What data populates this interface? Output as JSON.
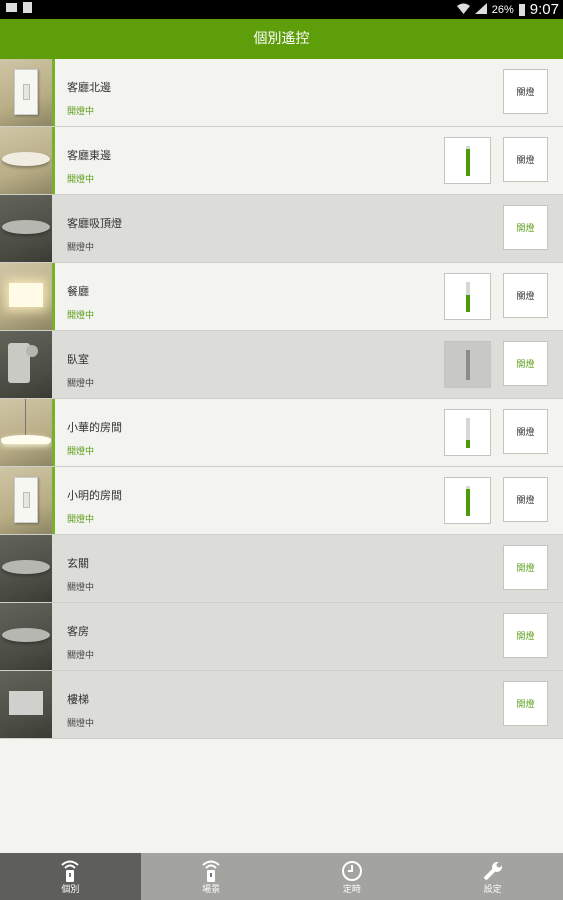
{
  "status_bar": {
    "battery": "26%",
    "time": "9:07"
  },
  "header": {
    "title": "個別遙控"
  },
  "rooms": [
    {
      "name": "客廳北邊",
      "status": "開燈中",
      "state": "on",
      "button": "關燈",
      "icon": "wall-switch",
      "dimmer": null
    },
    {
      "name": "客廳東邊",
      "status": "開燈中",
      "state": "on",
      "button": "關燈",
      "icon": "ceiling-disk",
      "dimmer": 0.9
    },
    {
      "name": "客廳吸頂燈",
      "status": "關燈中",
      "state": "off",
      "button": "開燈",
      "icon": "ceiling-disk",
      "dimmer": null
    },
    {
      "name": "餐廳",
      "status": "開燈中",
      "state": "on",
      "button": "關燈",
      "icon": "wall-lamp",
      "dimmer": 0.55
    },
    {
      "name": "臥室",
      "status": "關燈中",
      "state": "off",
      "button": "開燈",
      "icon": "spot-lamp",
      "dimmer": 0.0
    },
    {
      "name": "小華的房間",
      "status": "開燈中",
      "state": "on",
      "button": "關燈",
      "icon": "pendant-lamp",
      "dimmer": 0.25
    },
    {
      "name": "小明的房間",
      "status": "開燈中",
      "state": "on",
      "button": "關燈",
      "icon": "wall-switch",
      "dimmer": 0.9
    },
    {
      "name": "玄關",
      "status": "關燈中",
      "state": "off",
      "button": "開燈",
      "icon": "downlight",
      "dimmer": null
    },
    {
      "name": "客房",
      "status": "關燈中",
      "state": "off",
      "button": "開燈",
      "icon": "ceiling-disk",
      "dimmer": null
    },
    {
      "name": "樓梯",
      "status": "關燈中",
      "state": "off",
      "button": "開燈",
      "icon": "wall-box",
      "dimmer": null
    }
  ],
  "tabs": [
    {
      "label": "個別",
      "icon": "remote-icon",
      "active": true
    },
    {
      "label": "場景",
      "icon": "remote-icon",
      "active": false
    },
    {
      "label": "定時",
      "icon": "clock-icon",
      "active": false
    },
    {
      "label": "設定",
      "icon": "wrench-icon",
      "active": false
    }
  ],
  "colors": {
    "header": "#5f9e0b",
    "on_text": "#5a9c18",
    "accent": "#74b329"
  }
}
